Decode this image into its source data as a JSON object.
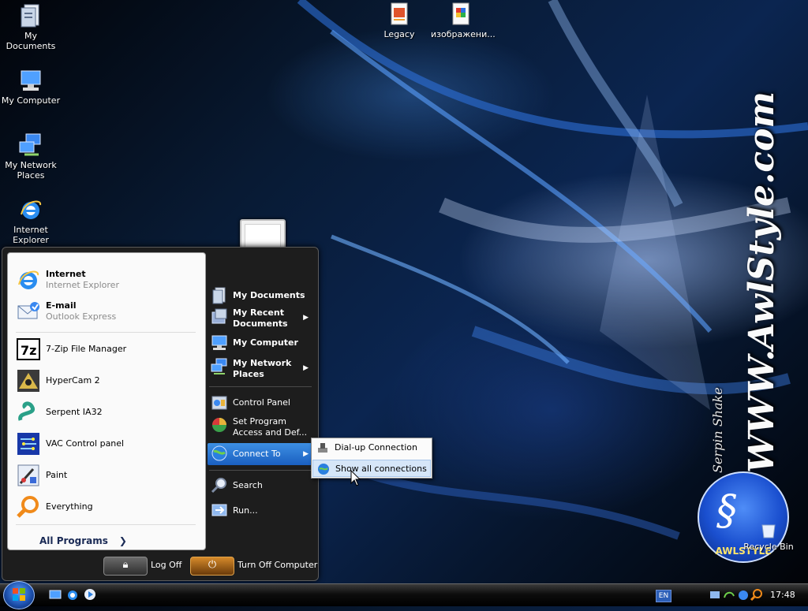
{
  "desktop": {
    "icons": [
      {
        "label": "My Documents",
        "icon": "my-documents-icon"
      },
      {
        "label": "My Computer",
        "icon": "my-computer-icon"
      },
      {
        "label": "My Network Places",
        "icon": "network-places-icon"
      },
      {
        "label": "Internet Explorer",
        "icon": "internet-explorer-icon"
      },
      {
        "label": "Legacy",
        "icon": "legacy-file-icon"
      },
      {
        "label": "изображени...",
        "icon": "image-file-icon"
      },
      {
        "label": "Recycle Bin",
        "icon": "recycle-bin-icon"
      }
    ],
    "watermark": {
      "url": "WWW.AwlStyle.com",
      "author": "Serpin Shake",
      "logo_text": "AWLSTYLE"
    }
  },
  "start_menu": {
    "pinned": [
      {
        "title": "Internet",
        "subtitle": "Internet Explorer",
        "icon": "internet-explorer-icon"
      },
      {
        "title": "E-mail",
        "subtitle": "Outlook Express",
        "icon": "outlook-express-icon"
      }
    ],
    "recent": [
      {
        "label": "7-Zip File Manager",
        "icon": "7zip-icon"
      },
      {
        "label": "HyperCam 2",
        "icon": "hypercam-icon"
      },
      {
        "label": "Serpent IA32",
        "icon": "serpent-icon"
      },
      {
        "label": "VAC Control panel",
        "icon": "vac-control-panel-icon"
      },
      {
        "label": "Paint",
        "icon": "paint-icon"
      },
      {
        "label": "Everything",
        "icon": "everything-search-icon"
      }
    ],
    "all_programs": "All Programs",
    "right": {
      "my_documents": "My Documents",
      "my_recent_documents_1": "My Recent",
      "my_recent_documents_2": "Documents",
      "my_computer": "My Computer",
      "my_network_places_1": "My Network",
      "my_network_places_2": "Places",
      "control_panel": "Control Panel",
      "set_program_access_1": "Set Program",
      "set_program_access_2": "Access and Def...",
      "connect_to": "Connect To",
      "search": "Search",
      "run": "Run..."
    },
    "log_off": "Log Off",
    "turn_off": "Turn Off Computer"
  },
  "connect_submenu": {
    "items": [
      {
        "label": "Dial-up Connection",
        "icon": "dialup-icon"
      },
      {
        "label": "Show all connections",
        "icon": "network-connections-icon"
      }
    ]
  },
  "taskbar": {
    "language": "EN",
    "clock": "17:48"
  },
  "colors": {
    "menu_dark": "#1d1d1d",
    "highlight": "#2a74d4",
    "submenu_hover": "#d6e6f8"
  }
}
